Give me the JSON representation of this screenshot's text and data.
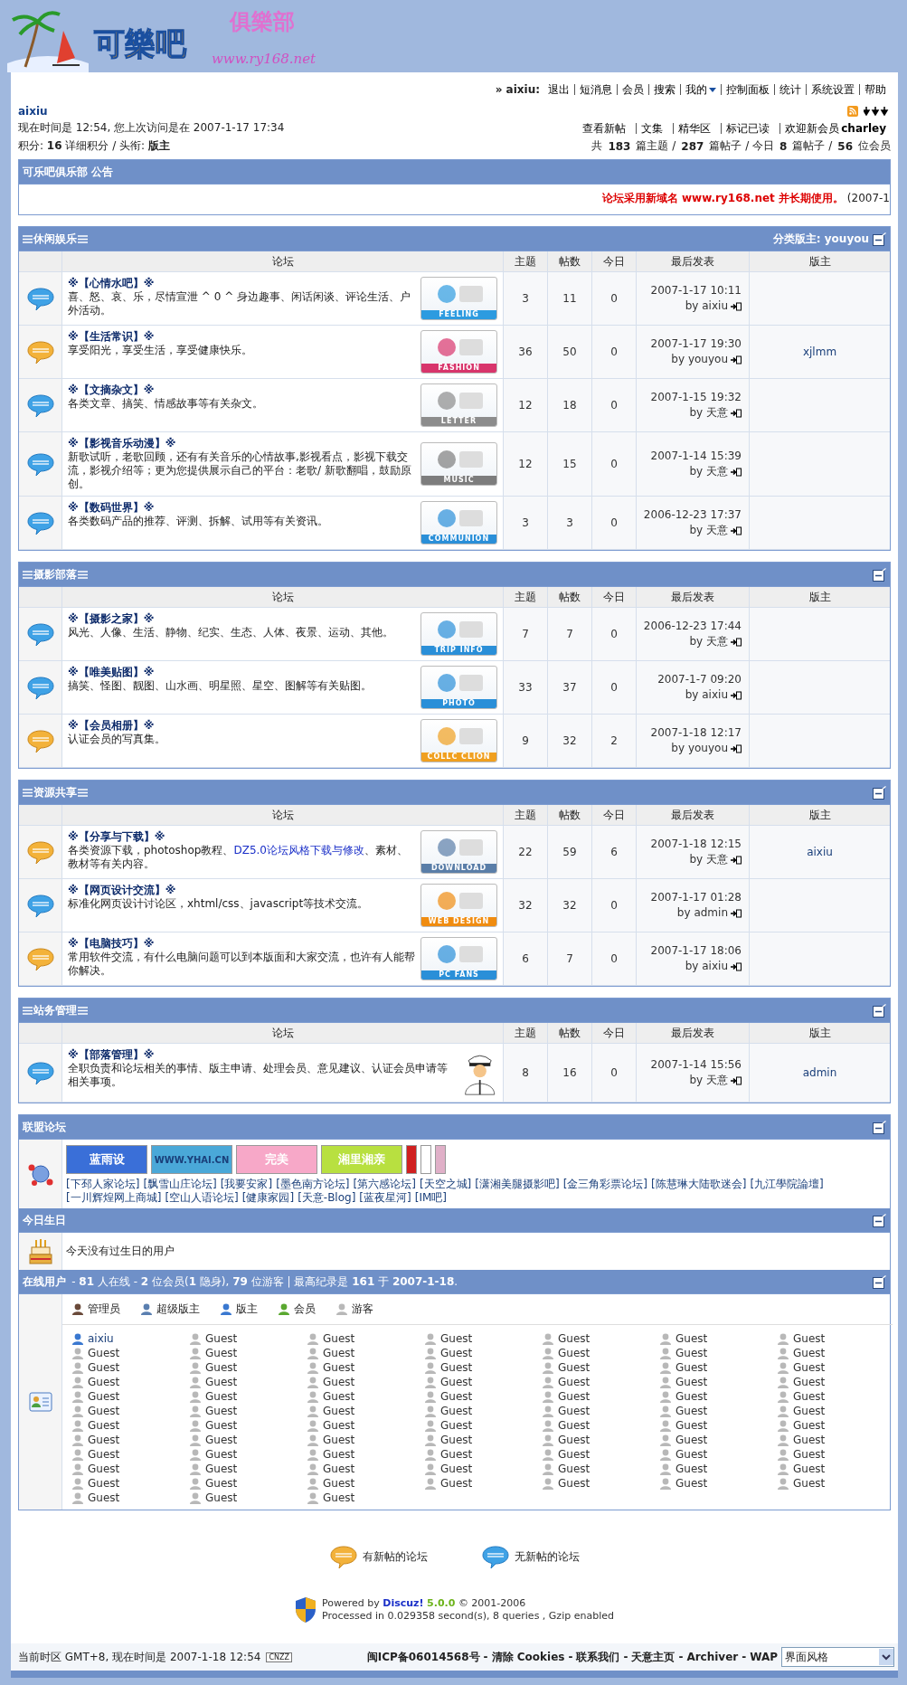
{
  "logo": {
    "title": "可樂吧",
    "subtitle": "俱樂部",
    "url": "www.ry168.net"
  },
  "nav": {
    "user": "» aixiu:",
    "links": [
      {
        "label": "退出",
        "dropdown": false
      },
      {
        "label": "短消息",
        "dropdown": false
      },
      {
        "label": "会员",
        "dropdown": false
      },
      {
        "label": "搜索",
        "dropdown": false
      },
      {
        "label": "我的",
        "dropdown": true
      },
      {
        "label": "控制面板",
        "dropdown": false
      },
      {
        "label": "统计",
        "dropdown": false
      },
      {
        "label": "系统设置",
        "dropdown": false
      },
      {
        "label": "帮助",
        "dropdown": false
      }
    ]
  },
  "user_panel": {
    "name": "aixiu",
    "time_line": "现在时间是  12:54, 您上次访问是在  2007-1-17 17:34",
    "points_line": "积分: **16** 详细积分 / 头衔: **版主**",
    "links": [
      "查看新帖",
      "文集",
      "精华区",
      "标记已读"
    ],
    "newest_member": "欢迎新会员 **charley**",
    "stats": "共 **183** 篇主题 / **287** 篇帖子 / 今日 **8** 篇帖子 / **56** 位会员"
  },
  "announcement": {
    "title": "可乐吧俱乐部 公告",
    "text": "论坛采用新域名 www.ry168.net 并长期使用。",
    "date": "(2007-1"
  },
  "categories": [
    {
      "title": "休闲娱乐",
      "moderator": "分类版主: youyou",
      "columns": [
        "论坛",
        "主题",
        "帖数",
        "今日",
        "最后发表",
        "版主"
      ],
      "forums": [
        {
          "name": "※【心情水吧】※",
          "desc": "喜、怒、哀、乐，尽情宣泄  ^ 0 ^  身边趣事、闲话闲谈、评论生活、户外活动。",
          "new_posts": false,
          "image": {
            "kind": "badge",
            "caption": "FEELING",
            "color": "#2d9be0"
          },
          "topics": "3",
          "posts": "11",
          "today": "0",
          "last_date": "2007-1-17 10:11",
          "last_by": "by aixiu"
        },
        {
          "name": "※【生活常识】※",
          "desc": "享受阳光，享受生活，享受健康快乐。",
          "new_posts": true,
          "image": {
            "kind": "badge",
            "caption": "FASHION",
            "color": "#d8356c"
          },
          "topics": "36",
          "posts": "50",
          "today": "0",
          "last_date": "2007-1-17 19:30",
          "last_by": "by youyou",
          "moderator": "xjlmm"
        },
        {
          "name": "※【文摘杂文】※",
          "desc": "各类文章、搞笑、情感故事等有关杂文。",
          "new_posts": false,
          "image": {
            "kind": "badge",
            "caption": "LETTER",
            "color": "#8c8c8c"
          },
          "topics": "12",
          "posts": "18",
          "today": "0",
          "last_date": "2007-1-15 19:32",
          "last_by": "by 天意"
        },
        {
          "name": "※【影视音乐动漫】※",
          "desc": "新歌试听，老歌回顾，还有有关音乐的心情故事,影视看点，影视下载交流，影视介绍等；更为您提供展示自己的平台：老歌/ 新歌翻唱，鼓励原创。",
          "new_posts": false,
          "image": {
            "kind": "badge",
            "caption": "MUSIC",
            "color": "#7d7d7d"
          },
          "topics": "12",
          "posts": "15",
          "today": "0",
          "last_date": "2007-1-14 15:39",
          "last_by": "by 天意"
        },
        {
          "name": "※【数码世界】※",
          "desc": "各类数码产品的推荐、评测、拆解、试用等有关资讯。",
          "new_posts": false,
          "image": {
            "kind": "badge",
            "caption": "COMMUNION",
            "color": "#2a8fd8"
          },
          "topics": "3",
          "posts": "3",
          "today": "0",
          "last_date": "2006-12-23 17:37",
          "last_by": "by 天意"
        }
      ]
    },
    {
      "title": "摄影部落",
      "columns": [
        "论坛",
        "主题",
        "帖数",
        "今日",
        "最后发表",
        "版主"
      ],
      "forums": [
        {
          "name": "※【摄影之家】※",
          "desc": "风光、人像、生活、静物、纪实、生态、人体、夜景、运动、其他。",
          "new_posts": false,
          "image": {
            "kind": "badge",
            "caption": "TRIP INFO",
            "color": "#2a8fd8"
          },
          "topics": "7",
          "posts": "7",
          "today": "0",
          "last_date": "2006-12-23 17:44",
          "last_by": "by 天意"
        },
        {
          "name": "※【唯美贴图】※",
          "desc": "搞笑、怪图、靓图、山水画、明星照、星空、图解等有关贴图。",
          "new_posts": false,
          "image": {
            "kind": "badge",
            "caption": "PHOTO",
            "color": "#2a8fd8"
          },
          "topics": "33",
          "posts": "37",
          "today": "0",
          "last_date": "2007-1-7 09:20",
          "last_by": "by aixiu"
        },
        {
          "name": "※【会员相册】※",
          "desc": "认证会员的写真集。",
          "new_posts": true,
          "image": {
            "kind": "badge",
            "caption": "COLLC CLION",
            "color": "#f0a020"
          },
          "topics": "9",
          "posts": "32",
          "today": "2",
          "last_date": "2007-1-18 12:17",
          "last_by": "by youyou"
        }
      ]
    },
    {
      "title": "资源共享",
      "columns": [
        "论坛",
        "主题",
        "帖数",
        "今日",
        "最后发表",
        "版主"
      ],
      "forums": [
        {
          "name": "※【分享与下载】※",
          "desc": "各类资源下载，photoshop教程、",
          "desc_link": "DZ5.0论坛风格下载与修改",
          "desc_rest": "、素材、教材等有关内容。",
          "new_posts": true,
          "image": {
            "kind": "badge",
            "caption": "DOWNLOAD",
            "color": "#5a7ea8"
          },
          "topics": "22",
          "posts": "59",
          "today": "6",
          "last_date": "2007-1-18 12:15",
          "last_by": "by 天意",
          "moderator": "aixiu"
        },
        {
          "name": "※【网页设计交流】※",
          "desc": "标准化网页设计讨论区，xhtml/css、javascript等技术交流。",
          "new_posts": false,
          "image": {
            "kind": "badge",
            "caption": "WEB DESIGN",
            "color": "#f08c10"
          },
          "topics": "32",
          "posts": "32",
          "today": "0",
          "last_date": "2007-1-17 01:28",
          "last_by": "by admin"
        },
        {
          "name": "※【电脑技巧】※",
          "desc": "常用软件交流，有什么电脑问题可以到本版面和大家交流，也许有人能帮你解决。",
          "new_posts": true,
          "image": {
            "kind": "badge",
            "caption": "PC FANS",
            "color": "#2a8fd8"
          },
          "topics": "6",
          "posts": "7",
          "today": "0",
          "last_date": "2007-1-17 18:06",
          "last_by": "by aixiu"
        }
      ]
    },
    {
      "title": "站务管理",
      "columns": [
        "论坛",
        "主题",
        "帖数",
        "今日",
        "最后发表",
        "版主"
      ],
      "forums": [
        {
          "name": "※【部落管理】※",
          "desc": "全职负责和论坛相关的事情、版主申请、处理会员、意见建议、认证会员申请等相关事项。",
          "new_posts": false,
          "image": {
            "kind": "officer"
          },
          "topics": "8",
          "posts": "16",
          "today": "0",
          "last_date": "2007-1-14 15:56",
          "last_by": "by 天意",
          "moderator": "admin"
        }
      ]
    }
  ],
  "union": {
    "title": "联盟论坛",
    "banners": [
      {
        "label": "蓝雨设",
        "color": "#3a6fd8"
      },
      {
        "label": "WWW.YHAI.CN",
        "color": "#4aa8d8"
      },
      {
        "label": "完美",
        "color": "#f7a8c8"
      },
      {
        "label": "湘里湘亲",
        "color": "#b8e040"
      },
      {
        "color": "#d02020"
      },
      {
        "color": "#ffffff"
      },
      {
        "color": "#e0b0c8"
      }
    ],
    "links": [
      "[下邳人家论坛]",
      "[飘雪山庄论坛]",
      "[我要安家]",
      "[墨色南方论坛]",
      "[第六感论坛]",
      "[天空之城]",
      "[潇湘美腿摄影吧]",
      "[金三角彩票论坛]",
      "[陈慧琳大陆歌迷会]",
      "[九江學院論壇]",
      "[一川辉煌网上商城]",
      "[空山人语论坛]",
      "[健康家园]",
      "[天意-Blog]",
      "[蓝夜星河]",
      "[IM吧]"
    ]
  },
  "birthday": {
    "title": "今日生日",
    "text": "今天没有过生日的用户"
  },
  "online": {
    "title": "在线用户",
    "summary": "- **81** 人在线  - **2** 位会员(**1** 隐身), **79** 位游客  | 最高纪录是  **161** 于  **2007-1-18**.",
    "legend": [
      {
        "label": "管理员",
        "kind": "admin"
      },
      {
        "label": "超级版主",
        "kind": "supermod"
      },
      {
        "label": "版主",
        "kind": "moderator"
      },
      {
        "label": "会员",
        "kind": "member"
      },
      {
        "label": "游客",
        "kind": "guest"
      }
    ],
    "users": [
      {
        "name": "aixiu",
        "kind": "moderator"
      },
      {
        "name": "Guest",
        "kind": "guest"
      },
      {
        "name": "Guest",
        "kind": "guest"
      },
      {
        "name": "Guest",
        "kind": "guest"
      },
      {
        "name": "Guest",
        "kind": "guest"
      },
      {
        "name": "Guest",
        "kind": "guest"
      },
      {
        "name": "Guest",
        "kind": "guest"
      },
      {
        "name": "Guest",
        "kind": "guest"
      },
      {
        "name": "Guest",
        "kind": "guest"
      },
      {
        "name": "Guest",
        "kind": "guest"
      },
      {
        "name": "Guest",
        "kind": "guest"
      },
      {
        "name": "Guest",
        "kind": "guest"
      },
      {
        "name": "Guest",
        "kind": "guest"
      },
      {
        "name": "Guest",
        "kind": "guest"
      },
      {
        "name": "Guest",
        "kind": "guest"
      },
      {
        "name": "Guest",
        "kind": "guest"
      },
      {
        "name": "Guest",
        "kind": "guest"
      },
      {
        "name": "Guest",
        "kind": "guest"
      },
      {
        "name": "Guest",
        "kind": "guest"
      },
      {
        "name": "Guest",
        "kind": "guest"
      },
      {
        "name": "Guest",
        "kind": "guest"
      },
      {
        "name": "Guest",
        "kind": "guest"
      },
      {
        "name": "Guest",
        "kind": "guest"
      },
      {
        "name": "Guest",
        "kind": "guest"
      },
      {
        "name": "Guest",
        "kind": "guest"
      },
      {
        "name": "Guest",
        "kind": "guest"
      },
      {
        "name": "Guest",
        "kind": "guest"
      },
      {
        "name": "Guest",
        "kind": "guest"
      },
      {
        "name": "Guest",
        "kind": "guest"
      },
      {
        "name": "Guest",
        "kind": "guest"
      },
      {
        "name": "Guest",
        "kind": "guest"
      },
      {
        "name": "Guest",
        "kind": "guest"
      },
      {
        "name": "Guest",
        "kind": "guest"
      },
      {
        "name": "Guest",
        "kind": "guest"
      },
      {
        "name": "Guest",
        "kind": "guest"
      },
      {
        "name": "Guest",
        "kind": "guest"
      },
      {
        "name": "Guest",
        "kind": "guest"
      },
      {
        "name": "Guest",
        "kind": "guest"
      },
      {
        "name": "Guest",
        "kind": "guest"
      },
      {
        "name": "Guest",
        "kind": "guest"
      },
      {
        "name": "Guest",
        "kind": "guest"
      },
      {
        "name": "Guest",
        "kind": "guest"
      },
      {
        "name": "Guest",
        "kind": "guest"
      },
      {
        "name": "Guest",
        "kind": "guest"
      },
      {
        "name": "Guest",
        "kind": "guest"
      },
      {
        "name": "Guest",
        "kind": "guest"
      },
      {
        "name": "Guest",
        "kind": "guest"
      },
      {
        "name": "Guest",
        "kind": "guest"
      },
      {
        "name": "Guest",
        "kind": "guest"
      },
      {
        "name": "Guest",
        "kind": "guest"
      },
      {
        "name": "Guest",
        "kind": "guest"
      },
      {
        "name": "Guest",
        "kind": "guest"
      },
      {
        "name": "Guest",
        "kind": "guest"
      },
      {
        "name": "Guest",
        "kind": "guest"
      },
      {
        "name": "Guest",
        "kind": "guest"
      },
      {
        "name": "Guest",
        "kind": "guest"
      },
      {
        "name": "Guest",
        "kind": "guest"
      },
      {
        "name": "Guest",
        "kind": "guest"
      },
      {
        "name": "Guest",
        "kind": "guest"
      },
      {
        "name": "Guest",
        "kind": "guest"
      },
      {
        "name": "Guest",
        "kind": "guest"
      },
      {
        "name": "Guest",
        "kind": "guest"
      },
      {
        "name": "Guest",
        "kind": "guest"
      },
      {
        "name": "Guest",
        "kind": "guest"
      },
      {
        "name": "Guest",
        "kind": "guest"
      },
      {
        "name": "Guest",
        "kind": "guest"
      },
      {
        "name": "Guest",
        "kind": "guest"
      },
      {
        "name": "Guest",
        "kind": "guest"
      },
      {
        "name": "Guest",
        "kind": "guest"
      },
      {
        "name": "Guest",
        "kind": "guest"
      },
      {
        "name": "Guest",
        "kind": "guest"
      },
      {
        "name": "Guest",
        "kind": "guest"
      },
      {
        "name": "Guest",
        "kind": "guest"
      },
      {
        "name": "Guest",
        "kind": "guest"
      },
      {
        "name": "Guest",
        "kind": "guest"
      },
      {
        "name": "Guest",
        "kind": "guest"
      },
      {
        "name": "Guest",
        "kind": "guest"
      },
      {
        "name": "Guest",
        "kind": "guest"
      },
      {
        "name": "Guest",
        "kind": "guest"
      },
      {
        "name": "Guest",
        "kind": "guest"
      }
    ]
  },
  "legend": [
    {
      "label": "有新帖的论坛",
      "new_posts": true
    },
    {
      "label": "无新帖的论坛",
      "new_posts": false
    }
  ],
  "powered": {
    "prefix": "Powered by",
    "product": "Discuz!",
    "version": "5.0.0",
    "copyright": "© 2001-2006",
    "processed": "Processed in 0.029358 second(s), 8 queries , Gzip enabled"
  },
  "footer": {
    "time": "当前时区  GMT+8, 现在时间是  2007-1-18 12:54",
    "counter": "CNZZ",
    "icp": "闽ICP备06014568号",
    "links": [
      {
        "sep": "-",
        "label": "清除 Cookies"
      },
      {
        "sep": "-",
        "label": "联系我们"
      },
      {
        "sep": "-",
        "label": "天意主页"
      },
      {
        "sep": "-",
        "label": "Archiver"
      },
      {
        "sep": "-",
        "label": "WAP"
      }
    ],
    "style_select": "界面风格"
  }
}
